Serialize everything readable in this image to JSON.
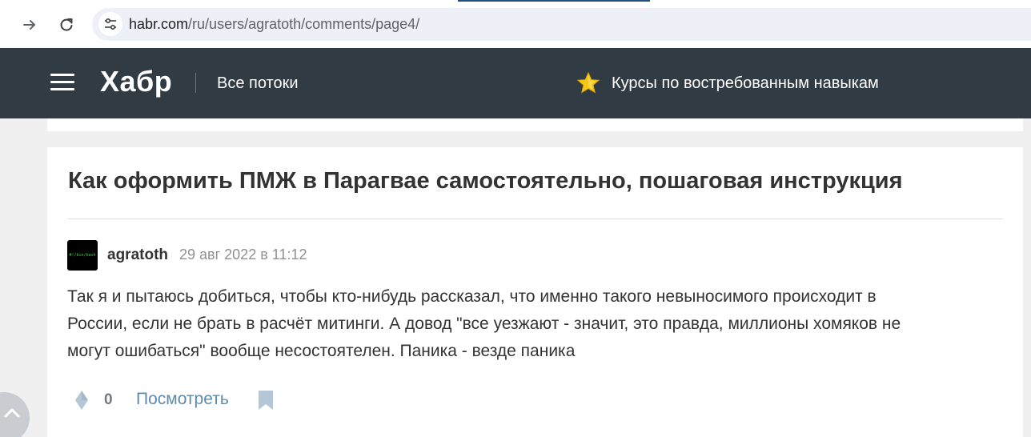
{
  "browser": {
    "url_host": "habr.com",
    "url_path": "/ru/users/agratoth/comments/page4/",
    "icons": {
      "forward": "arrow-right-icon",
      "reload": "reload-icon",
      "site_info": "tune-icon"
    }
  },
  "header": {
    "logo": "Хабр",
    "nav_label": "Все потоки",
    "promo_text": "Курсы по востребованным навыкам",
    "icons": {
      "menu": "hamburger-menu-icon",
      "promo": "star-icon"
    }
  },
  "post": {
    "title": "Как оформить ПМЖ в Парагвае самостоятельно, пошаговая инструкция"
  },
  "comment": {
    "author": "agratoth",
    "avatar_text": "#!/bin/bash",
    "datetime": "29 авг 2022 в 11:12",
    "lines": [
      "Так я и пытаюсь добиться, чтобы кто-нибудь рассказал, что именно такого невыносимого происходит в",
      "России, если не брать в расчёт митинги. А довод \"все уезжают - значит, это правда, миллионы хомяков не",
      "могут ошибаться\" вообще несостоятелен. Паника - везде паника"
    ],
    "score": "0",
    "view_label": "Посмотреть",
    "icons": {
      "vote": "diamond-vote-icon",
      "bookmark": "bookmark-icon",
      "scroll": "chevron-up-icon"
    }
  },
  "colors": {
    "header_bg": "#303b44",
    "page_bg": "#f0f0f0",
    "link": "#5e8aab",
    "star": "#f5c518"
  }
}
